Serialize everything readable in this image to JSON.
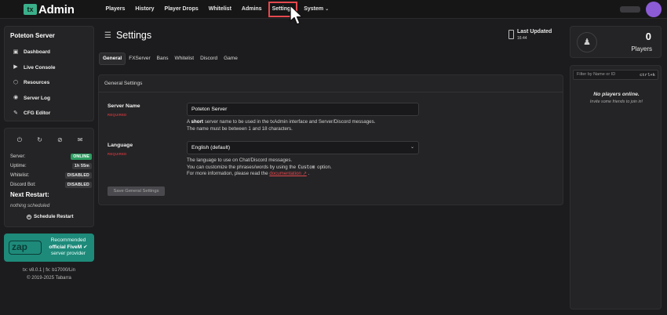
{
  "brand": {
    "mark": "tx",
    "name": "Admin"
  },
  "nav": {
    "items": [
      "Players",
      "History",
      "Player Drops",
      "Whitelist",
      "Admins",
      "Settings"
    ],
    "system": "System",
    "active": "Settings"
  },
  "sidebar": {
    "server_name": "Poteton Server",
    "menu": [
      "Dashboard",
      "Live Console",
      "Resources",
      "Server Log",
      "CFG Editor"
    ]
  },
  "status": {
    "rows": [
      {
        "label": "Server:",
        "value": "ONLINE"
      },
      {
        "label": "Uptime:",
        "value": "1h 55m"
      },
      {
        "label": "Whitelist:",
        "value": "DISABLED"
      },
      {
        "label": "Discord Bot:",
        "value": "DISABLED"
      }
    ],
    "next_restart_title": "Next Restart:",
    "next_restart_value": "nothing scheduled",
    "schedule_button": "Schedule Restart"
  },
  "promo": {
    "logo": "zap",
    "line1": "Recommended",
    "line2": "official FiveM",
    "line3": "server provider"
  },
  "footer": {
    "version": "tx: v8.0.1 | fx: b17000/Lin",
    "copyright": "© 2019-2025 Tabarra"
  },
  "page": {
    "title": "Settings",
    "last_updated_label": "Last Updated",
    "last_updated_value": "16:44"
  },
  "tabs": [
    "General",
    "FXServer",
    "Bans",
    "Whitelist",
    "Discord",
    "Game"
  ],
  "general": {
    "section_title": "General Settings",
    "server_name_label": "Server Name",
    "required": "REQUIRED",
    "server_name_value": "Poteton Server",
    "server_name_help_pre": "A ",
    "server_name_help_bold": "short",
    "server_name_help_post": " server name to be used in the txAdmin interface and Server/Discord messages.",
    "server_name_help_line2": "The name must be between 1 and 18 characters.",
    "language_label": "Language",
    "language_value": "English (default)",
    "language_help_line1": "The language to use on Chat/Discord messages.",
    "language_help_line2_pre": "You can customize the phrases/words by using the ",
    "language_help_code": "Custom",
    "language_help_line2_post": " option.",
    "language_help_line3_pre": "For more information, please read the ",
    "language_help_link": "documentation",
    "language_help_line3_post": ".",
    "save_button": "Save General Settings"
  },
  "players": {
    "count": "0",
    "label": "Players",
    "filter_placeholder": "Filter by Name or ID",
    "shortcut": "ctrl+k",
    "empty_title": "No players online.",
    "empty_subtitle": "Invite some friends to join in!"
  }
}
